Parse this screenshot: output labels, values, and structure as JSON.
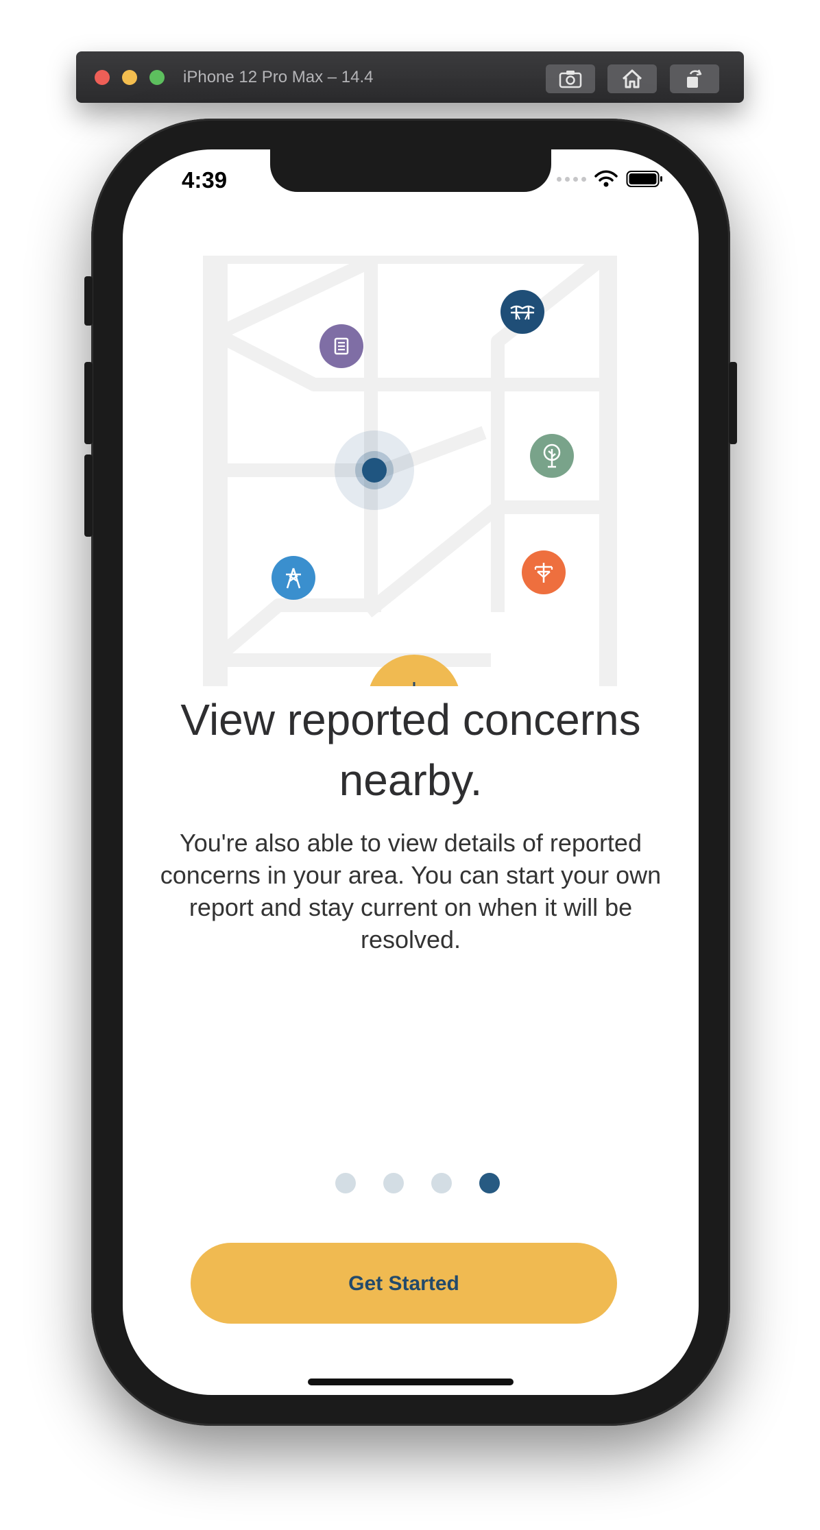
{
  "simulator": {
    "title": "iPhone 12 Pro Max – 14.4",
    "toolbar_icons": [
      "screenshot-icon",
      "home-icon",
      "rotate-icon"
    ]
  },
  "status_bar": {
    "time": "4:39",
    "icons": [
      "signal-dots-icon",
      "wifi-icon",
      "battery-icon"
    ]
  },
  "illustration": {
    "pins": [
      {
        "icon": "document-icon",
        "color": "#7f6ea5"
      },
      {
        "icon": "bridge-icon",
        "color": "#1f4e77"
      },
      {
        "icon": "tree-icon",
        "color": "#79a38a"
      },
      {
        "icon": "utility-pole-icon",
        "color": "#ee6f3e"
      },
      {
        "icon": "power-tower-icon",
        "color": "#3a8fce"
      }
    ],
    "location_color": "#1f5580",
    "add_button_color": "#f0ba51"
  },
  "onboarding": {
    "headline": "View reported concerns nearby.",
    "body": "You're also able to view details of reported concerns in your area. You can start your own report and stay current on when it will be resolved.",
    "page_count": 4,
    "current_page": 4,
    "cta_label": "Get Started"
  },
  "colors": {
    "accent": "#f0ba51",
    "primary": "#275a82",
    "dot_inactive": "#d3dde4"
  }
}
